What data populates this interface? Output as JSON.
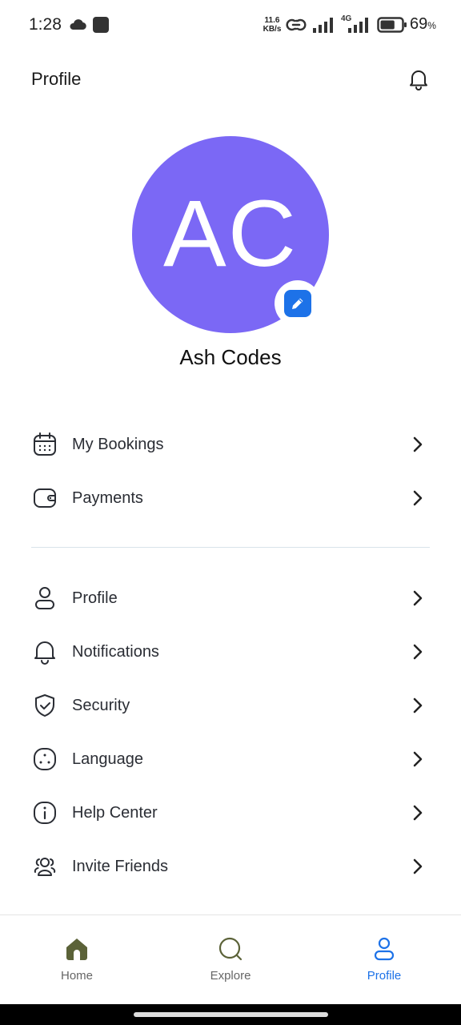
{
  "status_bar": {
    "time": "1:28",
    "net_speed_value": "11.6",
    "net_speed_unit": "KB/s",
    "network_type": "4G",
    "battery_percent": "69",
    "battery_suffix": "%",
    "battery_level": 0.69
  },
  "header": {
    "title": "Profile"
  },
  "profile": {
    "initials": "AC",
    "name": "Ash Codes",
    "avatar_color": "#7b68f5",
    "edit_color": "#1d72e8"
  },
  "menu_group_1": [
    {
      "label": "My Bookings",
      "icon": "calendar-icon"
    },
    {
      "label": "Payments",
      "icon": "wallet-icon"
    }
  ],
  "menu_group_2": [
    {
      "label": "Profile",
      "icon": "user-icon"
    },
    {
      "label": "Notifications",
      "icon": "bell-icon"
    },
    {
      "label": "Security",
      "icon": "shield-icon"
    },
    {
      "label": "Language",
      "icon": "language-icon"
    },
    {
      "label": "Help Center",
      "icon": "info-icon"
    },
    {
      "label": "Invite Friends",
      "icon": "users-icon"
    }
  ],
  "bottom_nav": {
    "items": [
      {
        "label": "Home",
        "icon": "home-icon",
        "active": false
      },
      {
        "label": "Explore",
        "icon": "search-icon",
        "active": false
      },
      {
        "label": "Profile",
        "icon": "user-icon",
        "active": true
      }
    ],
    "active_color": "#1d72e8",
    "home_color": "#5b6238"
  }
}
